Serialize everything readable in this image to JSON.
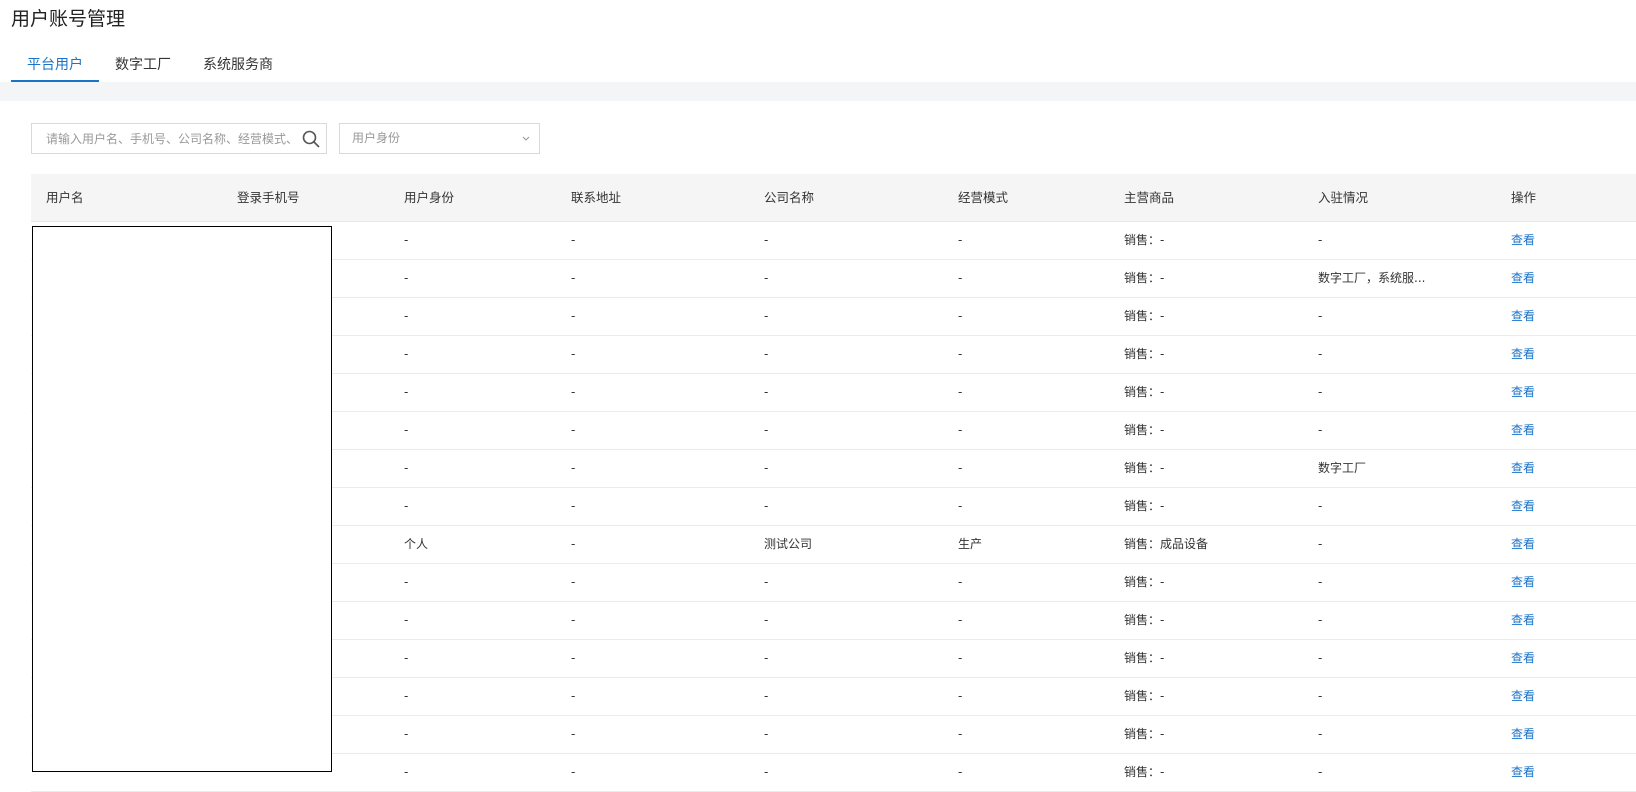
{
  "page": {
    "title": "用户账号管理"
  },
  "tabs": [
    {
      "label": "平台用户",
      "active": true
    },
    {
      "label": "数字工厂",
      "active": false
    },
    {
      "label": "系统服务商",
      "active": false
    }
  ],
  "filters": {
    "search_placeholder": "请输入用户名、手机号、公司名称、经营模式、",
    "search_icon": "search-icon",
    "identity_placeholder": "用户身份",
    "identity_icon": "chevron-down-icon"
  },
  "table": {
    "headers": [
      "用户名",
      "登录手机号",
      "用户身份",
      "联系地址",
      "公司名称",
      "经营模式",
      "主营商品",
      "入驻情况",
      "操作"
    ],
    "rows": [
      {
        "identity": "-",
        "address": "-",
        "company": "-",
        "mode": "-",
        "goods": "销售：-",
        "settled": "-",
        "action": "查看"
      },
      {
        "identity": "-",
        "address": "-",
        "company": "-",
        "mode": "-",
        "goods": "销售：-",
        "settled": "数字工厂，系统服...",
        "action": "查看"
      },
      {
        "identity": "-",
        "address": "-",
        "company": "-",
        "mode": "-",
        "goods": "销售：-",
        "settled": "-",
        "action": "查看"
      },
      {
        "identity": "-",
        "address": "-",
        "company": "-",
        "mode": "-",
        "goods": "销售：-",
        "settled": "-",
        "action": "查看"
      },
      {
        "identity": "-",
        "address": "-",
        "company": "-",
        "mode": "-",
        "goods": "销售：-",
        "settled": "-",
        "action": "查看"
      },
      {
        "identity": "-",
        "address": "-",
        "company": "-",
        "mode": "-",
        "goods": "销售：-",
        "settled": "-",
        "action": "查看"
      },
      {
        "identity": "-",
        "address": "-",
        "company": "-",
        "mode": "-",
        "goods": "销售：-",
        "settled": "数字工厂",
        "action": "查看"
      },
      {
        "identity": "-",
        "address": "-",
        "company": "-",
        "mode": "-",
        "goods": "销售：-",
        "settled": "-",
        "action": "查看"
      },
      {
        "identity": "个人",
        "address": "-",
        "company": "测试公司",
        "mode": "生产",
        "goods": "销售：成品设备",
        "settled": "-",
        "action": "查看"
      },
      {
        "identity": "-",
        "address": "-",
        "company": "-",
        "mode": "-",
        "goods": "销售：-",
        "settled": "-",
        "action": "查看"
      },
      {
        "identity": "-",
        "address": "-",
        "company": "-",
        "mode": "-",
        "goods": "销售：-",
        "settled": "-",
        "action": "查看"
      },
      {
        "identity": "-",
        "address": "-",
        "company": "-",
        "mode": "-",
        "goods": "销售：-",
        "settled": "-",
        "action": "查看"
      },
      {
        "identity": "-",
        "address": "-",
        "company": "-",
        "mode": "-",
        "goods": "销售：-",
        "settled": "-",
        "action": "查看"
      },
      {
        "identity": "-",
        "address": "-",
        "company": "-",
        "mode": "-",
        "goods": "销售：-",
        "settled": "-",
        "action": "查看"
      },
      {
        "identity": "-",
        "address": "-",
        "company": "-",
        "mode": "-",
        "goods": "销售：-",
        "settled": "-",
        "action": "查看"
      }
    ]
  },
  "colors": {
    "accent": "#1a73c8"
  }
}
